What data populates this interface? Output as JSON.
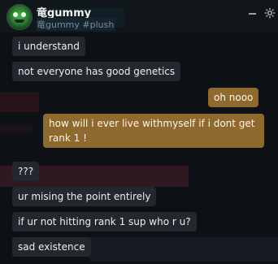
{
  "header": {
    "name": "竜gummy",
    "subtitle": "竜gummy #plush"
  },
  "messages": [
    {
      "sender": "other",
      "text": "i understand"
    },
    {
      "sender": "other",
      "text": "not everyone has good genetics"
    },
    {
      "sender": "me",
      "text": "oh nooo"
    },
    {
      "sender": "me",
      "text": "how will i ever live withmyself if i dont get rank 1 !"
    },
    {
      "sender": "other",
      "text": "???"
    },
    {
      "sender": "other",
      "text": "ur mising the point entirely"
    },
    {
      "sender": "other",
      "text": "if ur not hitting rank 1 sup who r u?"
    },
    {
      "sender": "other",
      "text": "sad existence"
    }
  ],
  "colors": {
    "background": "#0d1115",
    "other_bubble": "#23282e",
    "my_bubble": "#8f6a30",
    "muted_text": "#7d8a96"
  },
  "icons": {
    "minimize": "minimize-icon",
    "settings": "gear-icon"
  }
}
